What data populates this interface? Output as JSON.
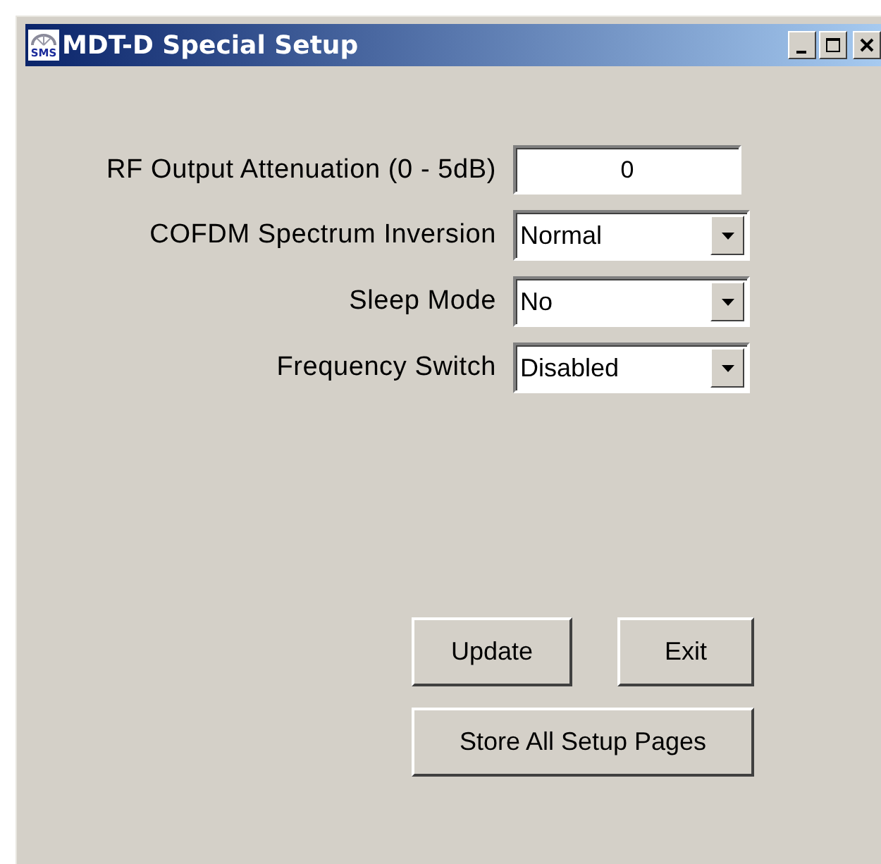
{
  "window": {
    "title": "MDT-D Special Setup",
    "logo_text": "SMS"
  },
  "fields": [
    {
      "kind": "text",
      "label": "RF Output Attenuation (0 - 5dB)",
      "value": "0"
    },
    {
      "kind": "dropdown",
      "label": "COFDM Spectrum Inversion",
      "value": "Normal"
    },
    {
      "kind": "dropdown",
      "label": "Sleep Mode",
      "value": "No"
    },
    {
      "kind": "dropdown",
      "label": "Frequency Switch",
      "value": "Disabled"
    }
  ],
  "button_rows": [
    [
      "Update",
      "Exit"
    ],
    [
      "Store All Setup Pages"
    ]
  ]
}
